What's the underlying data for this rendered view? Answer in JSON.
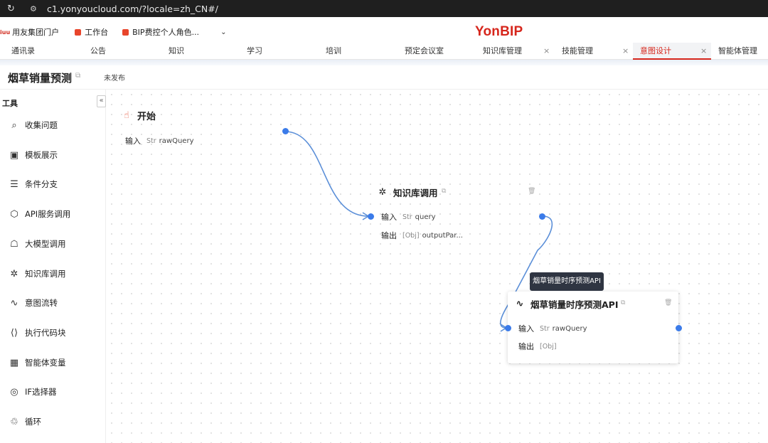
{
  "browser": {
    "url": "c1.yonyoucloud.com/?locale=zh_CN#/"
  },
  "bookmarks": [
    {
      "icon_text": "iuu",
      "label": "用友集团门户"
    },
    {
      "label": "工作台"
    },
    {
      "label": "BIP费控个人角色..."
    }
  ],
  "brand": "YonBIP",
  "tabs": [
    {
      "label": "通讯录"
    },
    {
      "label": "公告"
    },
    {
      "label": "知识"
    },
    {
      "label": "学习"
    },
    {
      "label": "培训"
    },
    {
      "label": "预定会议室"
    },
    {
      "label": "知识库管理",
      "close": "×"
    },
    {
      "label": "技能管理",
      "close": "×"
    },
    {
      "label": "意图设计",
      "close": "×",
      "active": true
    },
    {
      "label": "智能体管理"
    }
  ],
  "page": {
    "title": "烟草销量预测",
    "status": "未发布"
  },
  "sidebar": {
    "title": "工具",
    "collapse": "«",
    "items": [
      {
        "label": "收集问题",
        "icon": "collect-icon"
      },
      {
        "label": "模板展示",
        "icon": "template-icon"
      },
      {
        "label": "条件分支",
        "icon": "branch-icon"
      },
      {
        "label": "API服务调用",
        "icon": "api-icon"
      },
      {
        "label": "大模型调用",
        "icon": "llm-icon"
      },
      {
        "label": "知识库调用",
        "icon": "knowledge-icon"
      },
      {
        "label": "意图流转",
        "icon": "intent-icon"
      },
      {
        "label": "执行代码块",
        "icon": "code-icon"
      },
      {
        "label": "智能体变量",
        "icon": "variable-icon"
      },
      {
        "label": "IF选择器",
        "icon": "if-icon"
      },
      {
        "label": "循环",
        "icon": "loop-icon"
      }
    ]
  },
  "nodes": {
    "start": {
      "title": "开始",
      "input_label": "输入",
      "input_type": "Str",
      "input_value": "rawQuery"
    },
    "knowledge": {
      "title": "知识库调用",
      "input_label": "输入",
      "input_type": "Str",
      "input_value": "query",
      "output_label": "输出",
      "output_type": "[Obj]",
      "output_value": "outputPar..."
    },
    "api": {
      "title": "烟草销量时序预测API",
      "input_label": "输入",
      "input_type": "Str",
      "input_value": "rawQuery",
      "output_label": "输出",
      "output_type": "[Obj]",
      "tooltip": "烟草销量时序预测API"
    }
  },
  "colors": {
    "accent": "#d6261c",
    "port": "#3b7be9",
    "wire": "#5b8fd8"
  }
}
